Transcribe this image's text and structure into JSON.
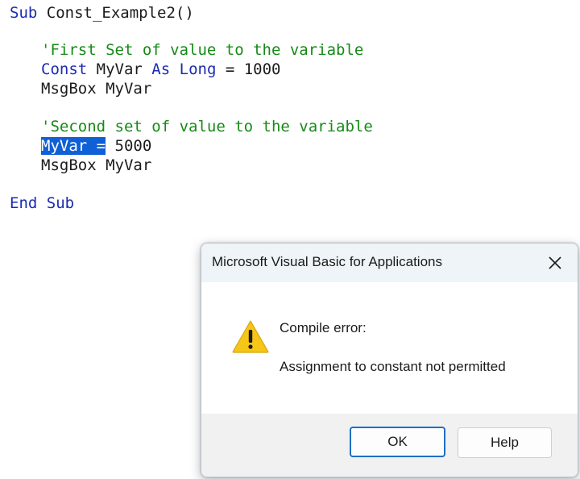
{
  "code": {
    "line1": {
      "keyword": "Sub",
      "rest": " Const_Example2()"
    },
    "comment1": "'First Set of value to the variable",
    "line3": {
      "kw_const": "Const",
      "mid": " MyVar ",
      "kw_as": "As",
      "space": " ",
      "kw_long": "Long",
      "rest": " = 1000"
    },
    "line4": "MsgBox MyVar",
    "comment2": "'Second set of value to the variable",
    "line6": {
      "selected": "MyVar =",
      "rest": " 5000"
    },
    "line7": "MsgBox MyVar",
    "line8": {
      "kw_end": "End",
      "space": " ",
      "kw_sub": "Sub"
    }
  },
  "dialog": {
    "title": "Microsoft Visual Basic for Applications",
    "icon": "warning-icon",
    "heading": "Compile error:",
    "message": "Assignment to constant not permitted",
    "buttons": {
      "ok": "OK",
      "help": "Help"
    },
    "close_icon": "close-icon"
  },
  "colors": {
    "keyword": "#1a2bb0",
    "comment": "#168a16",
    "selection": "#0f5fd6",
    "warning": "#f5c518",
    "ok_border": "#1f6fc5"
  }
}
